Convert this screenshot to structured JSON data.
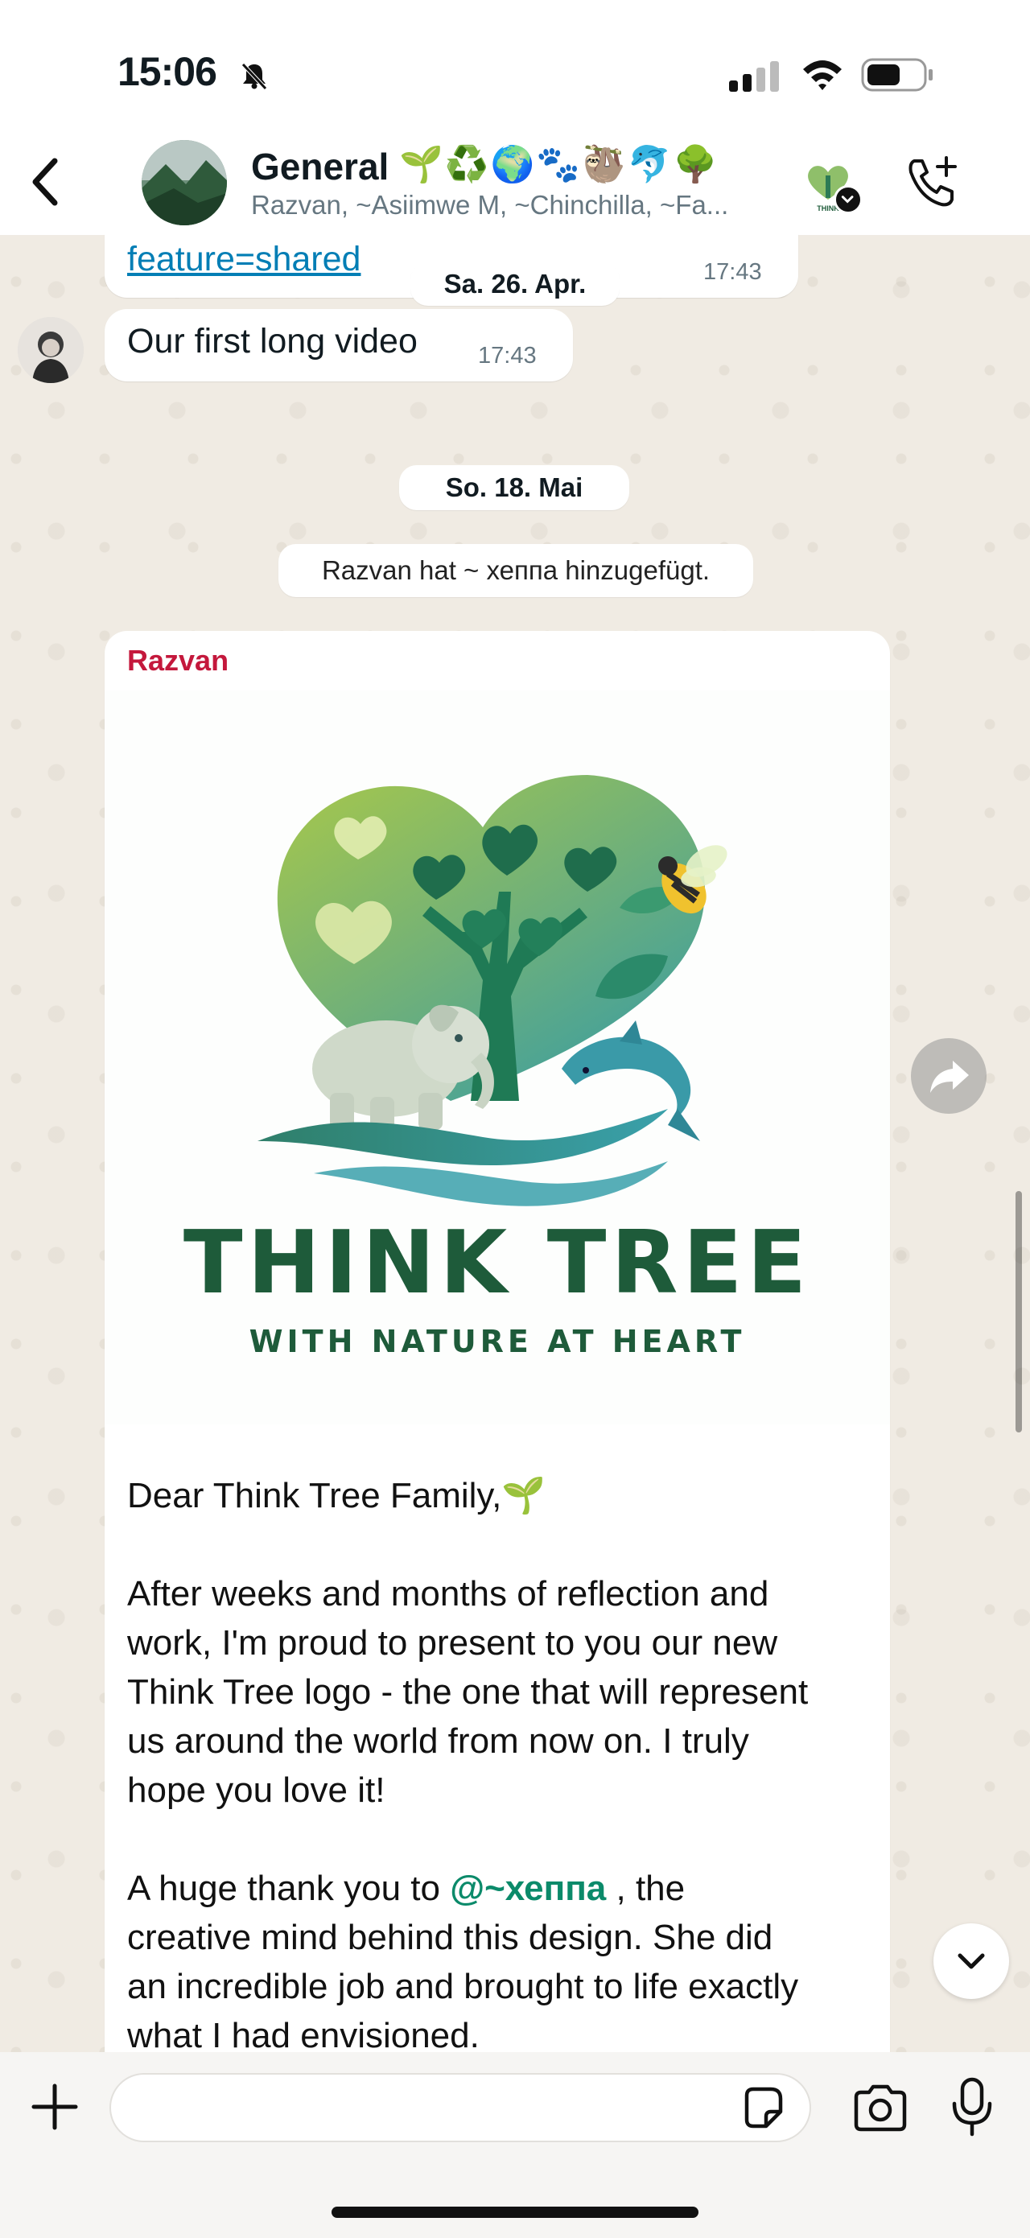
{
  "status_bar": {
    "time": "15:06",
    "icons": [
      "bell-slash-icon",
      "cellular-signal-icon",
      "wifi-icon",
      "battery-icon"
    ]
  },
  "header": {
    "title": "General",
    "title_emojis": "🌱♻️🌍🐾🦥🐬🌳",
    "subtitle": "Razvan, ~Asiimwe M, ~Chinchilla, ~Fa...",
    "thumb_text": "THINK"
  },
  "messages": {
    "link_msg": {
      "text": "feature=shared",
      "time": "17:43"
    },
    "date1": "Sa. 26. Apr.",
    "video_msg": {
      "text": "Our first long video",
      "time": "17:43"
    },
    "date2": "So. 18. Mai",
    "system_msg": "Razvan hat ~ хеппа hinzugefügt.",
    "post": {
      "sender": "Razvan",
      "logo_title": "THINK TREE",
      "logo_tagline": "WITH NATURE AT HEART",
      "greeting": "Dear Think Tree Family,",
      "greeting_emoji": "🌱",
      "para1_lines": [
        "After weeks and months of reflection and",
        "work, I'm proud to present to you our new",
        "Think Tree logo - the one that will represent",
        "us around the world from now on. I truly",
        "hope you love it!"
      ],
      "para2_pre": "A huge thank you to ",
      "mention": "@~хеппа",
      "para2_post": " , the",
      "para2_lines": [
        "creative mind behind this design. She did",
        "an incredible job and brought to life exactly",
        "what I had envisioned."
      ]
    }
  },
  "colors": {
    "sender": "#c4183c",
    "mention": "#0b8a6a",
    "logo_dark_green": "#1e5b3a",
    "link": "#027eb5"
  }
}
